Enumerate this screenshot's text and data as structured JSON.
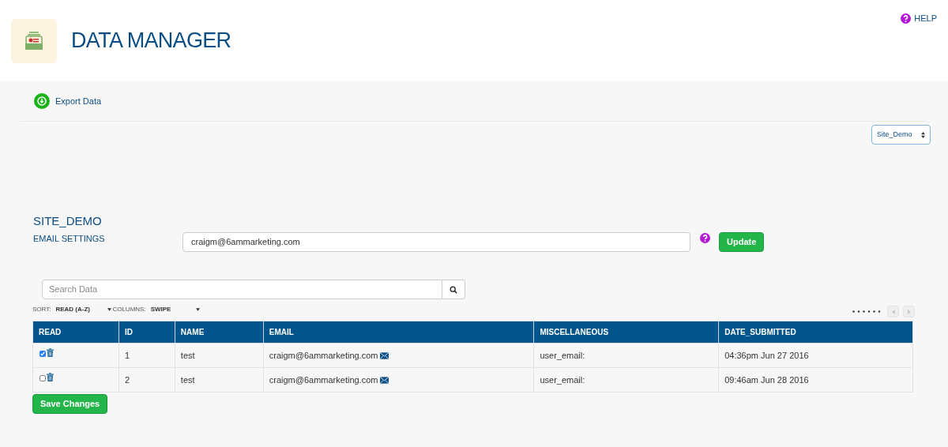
{
  "header": {
    "title": "DATA MANAGER",
    "help": "HELP"
  },
  "toolbar": {
    "export": "Export Data",
    "site_select": "Site_Demo"
  },
  "site": {
    "title": "SITE_DEMO",
    "email_label": "EMAIL SETTINGS",
    "email_value": "craigm@6ammarketing.com",
    "update": "Update"
  },
  "search": {
    "placeholder": "Search Data"
  },
  "sort": {
    "label": "SORT:",
    "value": "READ (A-Z)"
  },
  "columns_select": {
    "label": "COLUMNS:",
    "value": "SWIPE"
  },
  "pager": {
    "prev_disabled": true,
    "next_disabled": true
  },
  "table": {
    "columns": [
      "READ",
      "ID",
      "NAME",
      "EMAIL",
      "MISCELLANEOUS",
      "DATE_SUBMITTED"
    ],
    "rows": [
      {
        "checked": true,
        "id": "1",
        "name": "test",
        "email": "craigm@6ammarketing.com",
        "misc": "user_email:",
        "date": "04:36pm Jun 27 2016"
      },
      {
        "checked": false,
        "id": "2",
        "name": "test",
        "email": "craigm@6ammarketing.com",
        "misc": "user_email:",
        "date": "09:46am Jun 28 2016"
      }
    ]
  },
  "save": "Save Changes"
}
